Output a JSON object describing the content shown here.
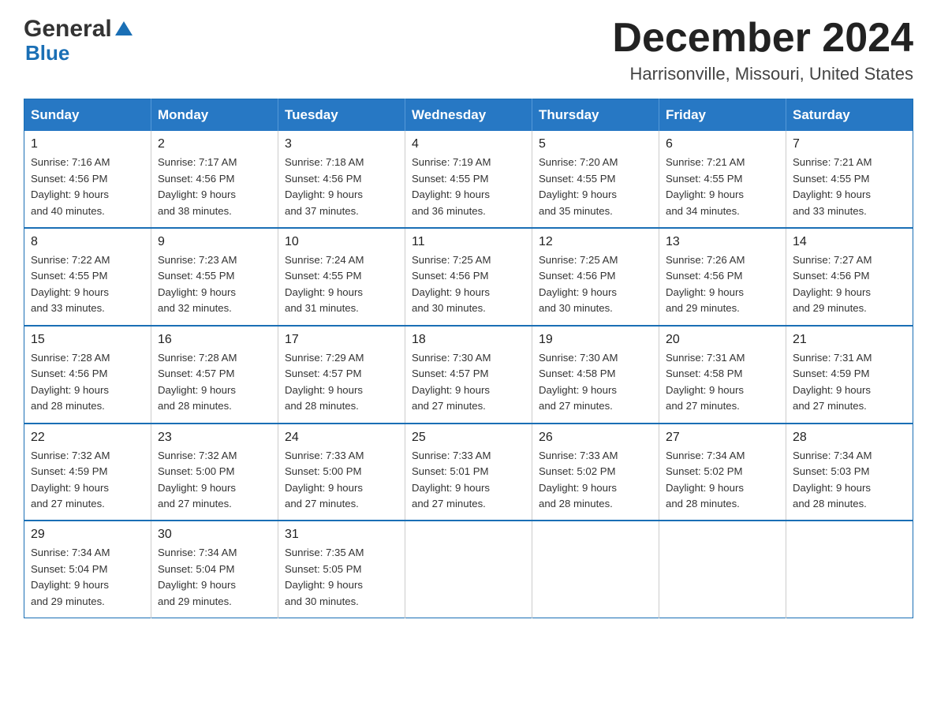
{
  "logo": {
    "general": "General",
    "blue": "Blue",
    "triangle": "▲"
  },
  "title": "December 2024",
  "subtitle": "Harrisonville, Missouri, United States",
  "days_of_week": [
    "Sunday",
    "Monday",
    "Tuesday",
    "Wednesday",
    "Thursday",
    "Friday",
    "Saturday"
  ],
  "weeks": [
    [
      {
        "day": "1",
        "sunrise": "7:16 AM",
        "sunset": "4:56 PM",
        "daylight": "9 hours and 40 minutes."
      },
      {
        "day": "2",
        "sunrise": "7:17 AM",
        "sunset": "4:56 PM",
        "daylight": "9 hours and 38 minutes."
      },
      {
        "day": "3",
        "sunrise": "7:18 AM",
        "sunset": "4:56 PM",
        "daylight": "9 hours and 37 minutes."
      },
      {
        "day": "4",
        "sunrise": "7:19 AM",
        "sunset": "4:55 PM",
        "daylight": "9 hours and 36 minutes."
      },
      {
        "day": "5",
        "sunrise": "7:20 AM",
        "sunset": "4:55 PM",
        "daylight": "9 hours and 35 minutes."
      },
      {
        "day": "6",
        "sunrise": "7:21 AM",
        "sunset": "4:55 PM",
        "daylight": "9 hours and 34 minutes."
      },
      {
        "day": "7",
        "sunrise": "7:21 AM",
        "sunset": "4:55 PM",
        "daylight": "9 hours and 33 minutes."
      }
    ],
    [
      {
        "day": "8",
        "sunrise": "7:22 AM",
        "sunset": "4:55 PM",
        "daylight": "9 hours and 33 minutes."
      },
      {
        "day": "9",
        "sunrise": "7:23 AM",
        "sunset": "4:55 PM",
        "daylight": "9 hours and 32 minutes."
      },
      {
        "day": "10",
        "sunrise": "7:24 AM",
        "sunset": "4:55 PM",
        "daylight": "9 hours and 31 minutes."
      },
      {
        "day": "11",
        "sunrise": "7:25 AM",
        "sunset": "4:56 PM",
        "daylight": "9 hours and 30 minutes."
      },
      {
        "day": "12",
        "sunrise": "7:25 AM",
        "sunset": "4:56 PM",
        "daylight": "9 hours and 30 minutes."
      },
      {
        "day": "13",
        "sunrise": "7:26 AM",
        "sunset": "4:56 PM",
        "daylight": "9 hours and 29 minutes."
      },
      {
        "day": "14",
        "sunrise": "7:27 AM",
        "sunset": "4:56 PM",
        "daylight": "9 hours and 29 minutes."
      }
    ],
    [
      {
        "day": "15",
        "sunrise": "7:28 AM",
        "sunset": "4:56 PM",
        "daylight": "9 hours and 28 minutes."
      },
      {
        "day": "16",
        "sunrise": "7:28 AM",
        "sunset": "4:57 PM",
        "daylight": "9 hours and 28 minutes."
      },
      {
        "day": "17",
        "sunrise": "7:29 AM",
        "sunset": "4:57 PM",
        "daylight": "9 hours and 28 minutes."
      },
      {
        "day": "18",
        "sunrise": "7:30 AM",
        "sunset": "4:57 PM",
        "daylight": "9 hours and 27 minutes."
      },
      {
        "day": "19",
        "sunrise": "7:30 AM",
        "sunset": "4:58 PM",
        "daylight": "9 hours and 27 minutes."
      },
      {
        "day": "20",
        "sunrise": "7:31 AM",
        "sunset": "4:58 PM",
        "daylight": "9 hours and 27 minutes."
      },
      {
        "day": "21",
        "sunrise": "7:31 AM",
        "sunset": "4:59 PM",
        "daylight": "9 hours and 27 minutes."
      }
    ],
    [
      {
        "day": "22",
        "sunrise": "7:32 AM",
        "sunset": "4:59 PM",
        "daylight": "9 hours and 27 minutes."
      },
      {
        "day": "23",
        "sunrise": "7:32 AM",
        "sunset": "5:00 PM",
        "daylight": "9 hours and 27 minutes."
      },
      {
        "day": "24",
        "sunrise": "7:33 AM",
        "sunset": "5:00 PM",
        "daylight": "9 hours and 27 minutes."
      },
      {
        "day": "25",
        "sunrise": "7:33 AM",
        "sunset": "5:01 PM",
        "daylight": "9 hours and 27 minutes."
      },
      {
        "day": "26",
        "sunrise": "7:33 AM",
        "sunset": "5:02 PM",
        "daylight": "9 hours and 28 minutes."
      },
      {
        "day": "27",
        "sunrise": "7:34 AM",
        "sunset": "5:02 PM",
        "daylight": "9 hours and 28 minutes."
      },
      {
        "day": "28",
        "sunrise": "7:34 AM",
        "sunset": "5:03 PM",
        "daylight": "9 hours and 28 minutes."
      }
    ],
    [
      {
        "day": "29",
        "sunrise": "7:34 AM",
        "sunset": "5:04 PM",
        "daylight": "9 hours and 29 minutes."
      },
      {
        "day": "30",
        "sunrise": "7:34 AM",
        "sunset": "5:04 PM",
        "daylight": "9 hours and 29 minutes."
      },
      {
        "day": "31",
        "sunrise": "7:35 AM",
        "sunset": "5:05 PM",
        "daylight": "9 hours and 30 minutes."
      },
      null,
      null,
      null,
      null
    ]
  ],
  "labels": {
    "sunrise": "Sunrise:",
    "sunset": "Sunset:",
    "daylight": "Daylight:"
  }
}
